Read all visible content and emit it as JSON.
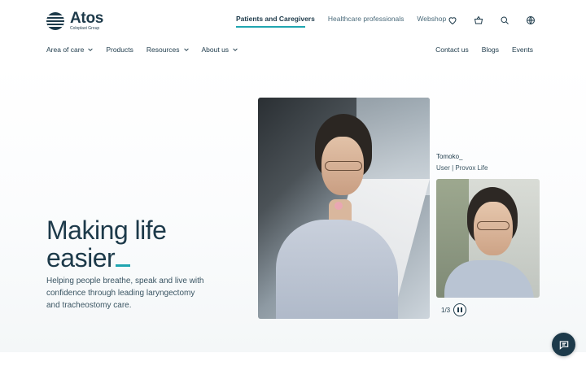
{
  "brand": {
    "name": "Atos",
    "tagline": "Coloplast Group",
    "accent": "#1fa5b0",
    "primary": "#1d3a4a"
  },
  "top_nav": {
    "items": [
      {
        "label": "Patients and Caregivers",
        "active": true
      },
      {
        "label": "Healthcare professionals",
        "active": false
      },
      {
        "label": "Webshop",
        "active": false
      }
    ],
    "icons": [
      "heart-icon",
      "basket-icon",
      "search-icon",
      "globe-icon"
    ]
  },
  "sub_nav": {
    "left": [
      {
        "label": "Area of care",
        "has_dropdown": true
      },
      {
        "label": "Products",
        "has_dropdown": false
      },
      {
        "label": "Resources",
        "has_dropdown": true
      },
      {
        "label": "About us",
        "has_dropdown": true
      }
    ],
    "right": [
      {
        "label": "Contact us"
      },
      {
        "label": "Blogs"
      },
      {
        "label": "Events"
      }
    ]
  },
  "hero": {
    "title_line1": "Making life",
    "title_line2": "easier",
    "subtitle": "Helping people breathe, speak and live with confidence through leading laryngectomy and tracheostomy care."
  },
  "carousel": {
    "person_name": "Tomoko_",
    "person_role": "User | Provox Life",
    "counter": "1/3"
  }
}
